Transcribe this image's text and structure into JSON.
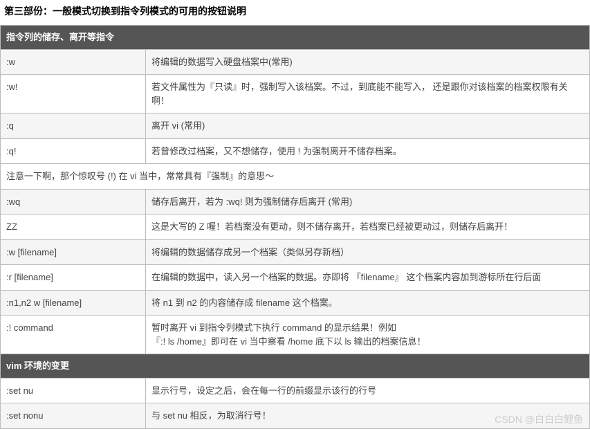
{
  "heading": "第三部份：一般模式切换到指令列模式的可用的按钮说明",
  "section1": {
    "title": "指令列的储存、离开等指令",
    "rows": [
      {
        "cmd": ":w",
        "desc": "将编辑的数据写入硬盘档案中(常用)"
      },
      {
        "cmd": ":w!",
        "desc": "若文件属性为『只读』时，强制写入该档案。不过，到底能不能写入， 还是跟你对该档案的档案权限有关啊！"
      },
      {
        "cmd": ":q",
        "desc": "离开 vi (常用)"
      },
      {
        "cmd": ":q!",
        "desc": "若曾修改过档案，又不想储存，使用 ! 为强制离开不储存档案。"
      }
    ],
    "note": "注意一下啊，那个惊叹号 (!) 在 vi 当中，常常具有『强制』的意思～",
    "rows2": [
      {
        "cmd": ":wq",
        "desc": "储存后离开，若为 :wq! 则为强制储存后离开 (常用)"
      },
      {
        "cmd": "ZZ",
        "desc": "这是大写的 Z 喔！若档案没有更动，则不储存离开，若档案已经被更动过，则储存后离开！"
      },
      {
        "cmd": ":w [filename]",
        "desc": "将编辑的数据储存成另一个档案（类似另存新档）"
      },
      {
        "cmd": ":r [filename]",
        "desc": "在编辑的数据中，读入另一个档案的数据。亦即将 『filename』 这个档案内容加到游标所在行后面"
      },
      {
        "cmd": ":n1,n2 w [filename]",
        "desc": "将 n1 到 n2 的内容储存成 filename 这个档案。"
      },
      {
        "cmd": ":! command",
        "desc": "暂时离开 vi 到指令列模式下执行 command 的显示结果！例如\n『:! ls /home』即可在 vi 当中察看 /home 底下以 ls 输出的档案信息！"
      }
    ]
  },
  "section2": {
    "title": "vim 环境的变更",
    "rows": [
      {
        "cmd": ":set nu",
        "desc": "显示行号，设定之后，会在每一行的前缀显示该行的行号"
      },
      {
        "cmd": ":set nonu",
        "desc": "与 set nu 相反，为取消行号！"
      }
    ]
  },
  "watermark": "CSDN @白白白鲤鱼"
}
